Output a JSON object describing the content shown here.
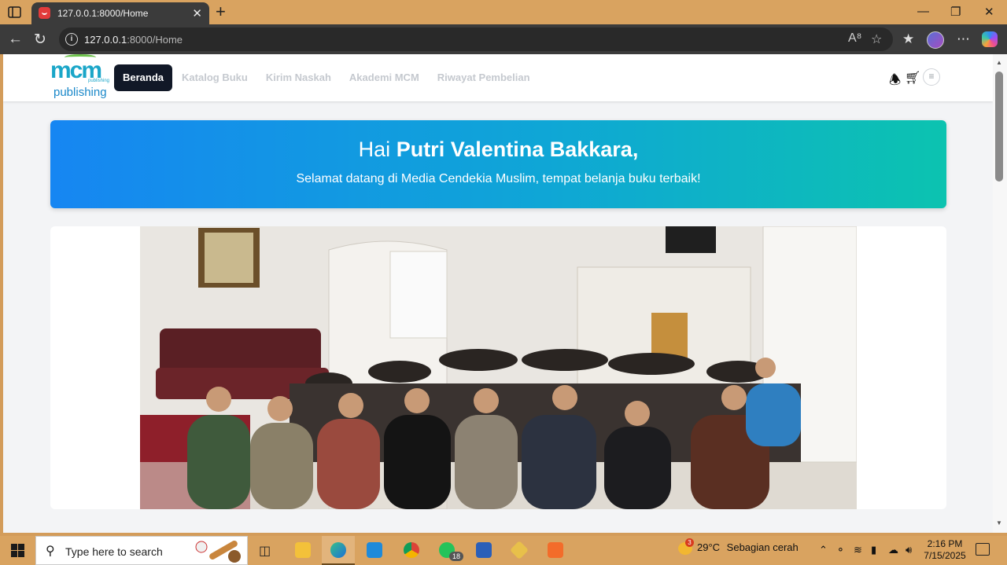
{
  "browser": {
    "tab_title": "127.0.0.1:8000/Home",
    "address_host": "127.0.0.1",
    "address_path": ":8000/Home",
    "new_tab_label": "+",
    "close_label": "✕"
  },
  "site": {
    "logo_mark": "mcm",
    "logo_small": "publishing",
    "logo_text": "publishing",
    "menu": [
      {
        "label": "Beranda",
        "active": true
      },
      {
        "label": "Katalog Buku",
        "active": false
      },
      {
        "label": "Kirim Naskah",
        "active": false
      },
      {
        "label": "Akademi MCM",
        "active": false
      },
      {
        "label": "Riwayat Pembelian",
        "active": false
      }
    ],
    "icons": [
      "bell-icon",
      "cart-icon",
      "menu-icon"
    ]
  },
  "hero": {
    "greeting_prefix": "Hai ",
    "user_name": "Putri Valentina Bakkara,",
    "subtitle": "Selamat datang di Media Cendekia Muslim, tempat belanja buku terbaik!",
    "gradient_from": "#1686f2",
    "gradient_to": "#0cc3b0"
  },
  "taskbar": {
    "search_placeholder": "Type here to search",
    "weather_badge": "3",
    "weather_temp": "29°C",
    "weather_desc": "Sebagian cerah",
    "whatsapp_badge": "18",
    "time": "2:16 PM",
    "date": "7/15/2025"
  },
  "colors": {
    "chrome_bg": "#d9a360",
    "nav_active_bg": "#111827",
    "page_bg": "#f3f4f6"
  }
}
